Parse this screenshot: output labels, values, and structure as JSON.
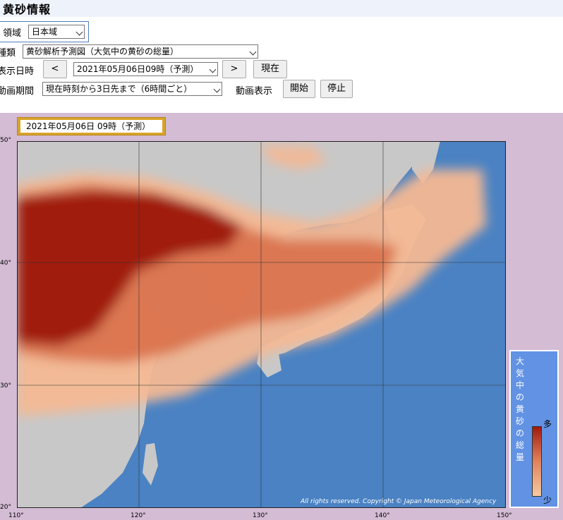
{
  "page": {
    "title": "黄砂情報"
  },
  "controls": {
    "region_label": "領域",
    "region_value": "日本域",
    "type_label": "種類",
    "type_value": "黄砂解析予測図（大気中の黄砂の総量）",
    "datetime_label": "表示日時",
    "prev_label": "<",
    "datetime_value": "2021年05月06日09時（予測）",
    "next_label": ">",
    "current_label": "現在",
    "animation_period_label": "動画期間",
    "animation_period_value": "現在時刻から3日先まで（6時間ごと）",
    "animation_display_label": "動画表示",
    "start_label": "開始",
    "stop_label": "停止"
  },
  "map": {
    "time_badge": "2021年05月06日 09時（予測）",
    "copyright": "All rights reserved. Copyright © Japan Meteorological Agency",
    "lat_labels": [
      "50°",
      "40°",
      "30°",
      "20°"
    ],
    "lon_labels": [
      "110°",
      "120°",
      "130°",
      "140°",
      "150°"
    ],
    "colors": {
      "sea": "#4a82c3",
      "land": "#c8c8c8",
      "dust_heavy": "#a01a0e",
      "dust_mid": "#d9714a",
      "dust_light": "#f4b893",
      "frame": "#d4bcd4"
    }
  },
  "legend": {
    "chars": [
      "大",
      "気",
      "中",
      "の",
      "黄",
      "砂",
      "の",
      "総",
      "量"
    ],
    "high": "多",
    "low": "少"
  }
}
